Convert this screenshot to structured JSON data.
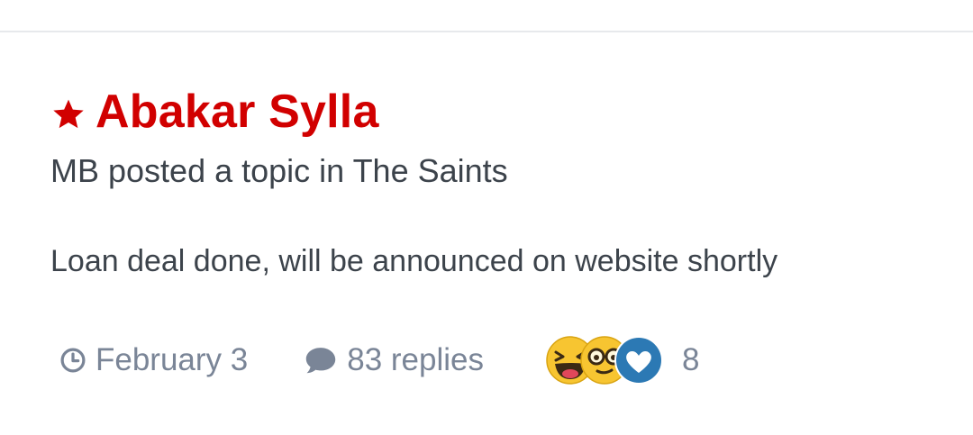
{
  "topic": {
    "title": "Abakar Sylla",
    "author": "MB",
    "posted_text": "posted a topic in",
    "forum": "The Saints",
    "snippet": "Loan deal done, will be announced on website shortly"
  },
  "stats": {
    "date": "February 3",
    "replies": "83 replies",
    "reaction_count": "8"
  },
  "colors": {
    "title": "#d10000",
    "meta_text": "#3c434b",
    "muted": "#7a8597",
    "divider": "#e7e9ec",
    "love_blue": "#2c79b4",
    "emoji_yellow": "#f7c531"
  },
  "icons": {
    "title_prefix": "star-icon",
    "date": "clock-icon",
    "replies": "comment-icon",
    "reactions": [
      "haha-icon",
      "thanks-icon",
      "love-icon"
    ]
  }
}
